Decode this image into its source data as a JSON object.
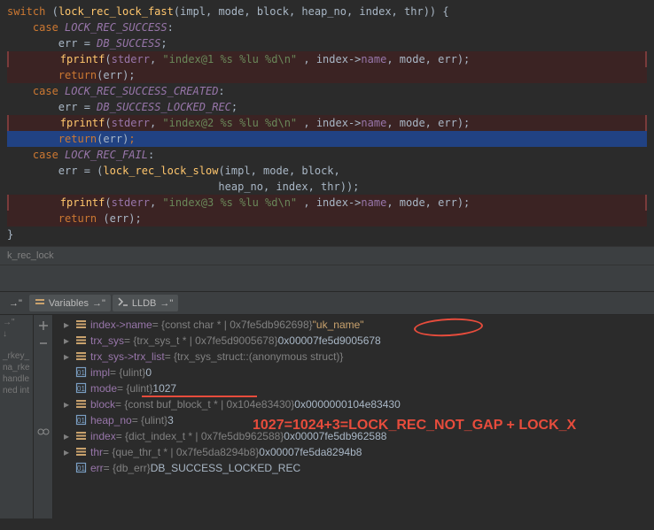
{
  "code": {
    "l0": {
      "a": "switch",
      "b": " (",
      "c": "lock_rec_lock_fast",
      "d": "(",
      "e": "impl",
      "f": ", ",
      "g": "mode",
      "h": ", ",
      "i": "block",
      "j": ", ",
      "k": "heap_no",
      "l": ", ",
      "m": "index",
      "n": ", ",
      "o": "thr",
      "p": ")) {"
    },
    "l1": {
      "a": "    case",
      "b": " LOCK_REC_SUCCESS",
      "c": ":"
    },
    "l2": {
      "a": "        ",
      "b": "err",
      "c": " = ",
      "d": "DB_SUCCESS",
      "e": ";"
    },
    "l3": {
      "a": "        ",
      "b": "fprintf",
      "c": "(",
      "d": "stderr",
      "e": ", ",
      "f": "\"index@1 %s %lu %d\\n\"",
      "g": " , ",
      "h": "index",
      "i": "->",
      "j": "name",
      "k": ", ",
      "l": "mode",
      "m": ", ",
      "n": "err",
      "o": ");"
    },
    "l4": {
      "a": "        ",
      "b": "return",
      "c": "(",
      "d": "err",
      "e": ");"
    },
    "l5": {
      "a": "    case",
      "b": " LOCK_REC_SUCCESS_CREATED",
      "c": ":"
    },
    "l6": {
      "a": "        ",
      "b": "err",
      "c": " = ",
      "d": "DB_SUCCESS_LOCKED_REC",
      "e": ";"
    },
    "l7": {
      "a": "        ",
      "b": "fprintf",
      "c": "(",
      "d": "stderr",
      "e": ", ",
      "f": "\"index@2 %s %lu %d\\n\"",
      "g": " , ",
      "h": "index",
      "i": "->",
      "j": "name",
      "k": ", ",
      "l": "mode",
      "m": ", ",
      "n": "err",
      "o": ");"
    },
    "l8": {
      "a": "        ",
      "b": "return",
      "c": "(",
      "d": "err",
      "e": ")",
      "f": ";"
    },
    "l9": {
      "a": "    case",
      "b": " LOCK_REC_FAIL",
      "c": ":"
    },
    "l10": {
      "a": "        ",
      "b": "err",
      "c": " = (",
      "d": "lock_rec_lock_slow",
      "e": "(",
      "f": "impl",
      "g": ", ",
      "h": "mode",
      "i": ", ",
      "j": "block",
      "k": ","
    },
    "l11": {
      "a": "                                 ",
      "b": "heap_no",
      "c": ", ",
      "d": "index",
      "e": ", ",
      "f": "thr",
      "g": "));"
    },
    "l12": {
      "a": "        ",
      "b": "fprintf",
      "c": "(",
      "d": "stderr",
      "e": ", ",
      "f": "\"index@3 %s %lu %d\\n\"",
      "g": " , ",
      "h": "index",
      "i": "->",
      "j": "name",
      "k": ", ",
      "l": "mode",
      "m": ", ",
      "n": "err",
      "o": ");"
    },
    "l13": {
      "a": "        ",
      "b": "return",
      "c": " (",
      "d": "err",
      "e": ");"
    },
    "l14": "}"
  },
  "breadcrumb": "k_rec_lock",
  "tabs": {
    "variables": "Variables",
    "lldb": "LLDB",
    "pin": "→\""
  },
  "sidebar": [
    "→\"",
    "↓",
    "",
    "",
    "",
    "",
    "",
    "",
    "_rkey_",
    "na_rke",
    "handle",
    "ned int"
  ],
  "vars": [
    {
      "name": "index->name",
      "type": "{const char * | 0x7fe5db962698}",
      "val": "\"uk_name\"",
      "kind": "stack",
      "tw": "▸"
    },
    {
      "name": "trx_sys",
      "type": "{trx_sys_t * | 0x7fe5d9005678}",
      "val": "0x00007fe5d9005678",
      "kind": "stack",
      "tw": "▸"
    },
    {
      "name": "trx_sys->trx_list",
      "type": "{trx_sys_struct::(anonymous struct)}",
      "val": "",
      "kind": "stack",
      "tw": "▸"
    },
    {
      "name": "impl",
      "type": "{ulint}",
      "val": "0",
      "kind": "box",
      "tw": ""
    },
    {
      "name": "mode",
      "type": "{ulint}",
      "val": "1027",
      "kind": "box",
      "tw": ""
    },
    {
      "name": "block",
      "type": "{const buf_block_t * | 0x104e83430}",
      "val": "0x0000000104e83430",
      "kind": "stack",
      "tw": "▸"
    },
    {
      "name": "heap_no",
      "type": "{ulint}",
      "val": "3",
      "kind": "box",
      "tw": ""
    },
    {
      "name": "index",
      "type": "{dict_index_t * | 0x7fe5db962588}",
      "val": "0x00007fe5db962588",
      "kind": "stack",
      "tw": "▸"
    },
    {
      "name": "thr",
      "type": "{que_thr_t * | 0x7fe5da8294b8}",
      "val": "0x00007fe5da8294b8",
      "kind": "stack",
      "tw": "▸"
    },
    {
      "name": "err",
      "type": "{db_err}",
      "val": "DB_SUCCESS_LOCKED_REC",
      "kind": "box",
      "tw": ""
    }
  ],
  "annotation": "1027=1024+3=LOCK_REC_NOT_GAP + LOCK_X"
}
